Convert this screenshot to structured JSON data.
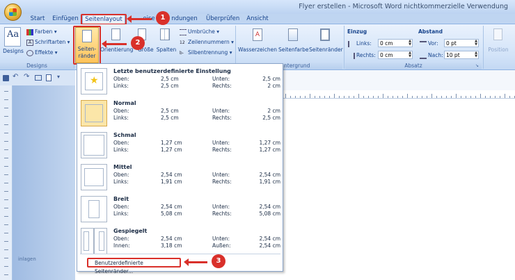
{
  "window": {
    "title": "Flyer erstellen - Microsoft Word nichtkommerzielle Verwendung"
  },
  "tabs": [
    "Start",
    "Einfügen",
    "Seitenlayout",
    "Verweise",
    "Sendungen",
    "Überprüfen",
    "Ansicht"
  ],
  "tabs_visible": {
    "start": "Start",
    "einfuegen": "Einfügen",
    "seitenlayout": "Seitenlayout",
    "verweise_tail": "eise",
    "sendungen_tail": "ndungen",
    "ueberpruefen": "Überprüfen",
    "ansicht": "Ansicht"
  },
  "ribbon": {
    "designs": {
      "label": "Designs",
      "group": "Designs",
      "farben": "Farben",
      "schriftarten": "Schriftarten",
      "effekte": "Effekte"
    },
    "seiteneinrichtung": {
      "seitenraender_line1": "Seiten-",
      "seitenraender_line2": "ränder",
      "orientierung": "Orientierung",
      "groesse": "Größe",
      "spalten": "Spalten",
      "umbrueche": "Umbrüche",
      "zeilennummern": "Zeilennummern",
      "silbentrennung": "Silbentrennung"
    },
    "seitenhintergrund": {
      "wasserzeichen": "Wasserzeichen",
      "seitenfarbe": "Seitenfarbe",
      "seitenraender": "Seitenränder",
      "group_tail": "ntergrund"
    },
    "absatz": {
      "group": "Absatz",
      "einzug": "Einzug",
      "links_label": "Links:",
      "links_value": "0 cm",
      "rechts_label": "Rechts:",
      "rechts_value": "0 cm",
      "abstand": "Abstand",
      "vor_label": "Vor:",
      "vor_value": "0 pt",
      "nach_label": "Nach:",
      "nach_value": "10 pt"
    },
    "position": "Position"
  },
  "margins_menu": {
    "items": [
      {
        "name": "Letzte benutzerdefinierte Einstellung",
        "k1": "Oben:",
        "v1": "2,5 cm",
        "k2": "Unten:",
        "v2": "2,5 cm",
        "k3": "Links:",
        "v3": "2,5 cm",
        "k4": "Rechts:",
        "v4": "2 cm"
      },
      {
        "name": "Normal",
        "k1": "Oben:",
        "v1": "2,5 cm",
        "k2": "Unten:",
        "v2": "2 cm",
        "k3": "Links:",
        "v3": "2,5 cm",
        "k4": "Rechts:",
        "v4": "2,5 cm"
      },
      {
        "name": "Schmal",
        "k1": "Oben:",
        "v1": "1,27 cm",
        "k2": "Unten:",
        "v2": "1,27 cm",
        "k3": "Links:",
        "v3": "1,27 cm",
        "k4": "Rechts:",
        "v4": "1,27 cm"
      },
      {
        "name": "Mittel",
        "k1": "Oben:",
        "v1": "2,54 cm",
        "k2": "Unten:",
        "v2": "2,54 cm",
        "k3": "Links:",
        "v3": "1,91 cm",
        "k4": "Rechts:",
        "v4": "1,91 cm"
      },
      {
        "name": "Breit",
        "k1": "Oben:",
        "v1": "2,54 cm",
        "k2": "Unten:",
        "v2": "2,54 cm",
        "k3": "Links:",
        "v3": "5,08 cm",
        "k4": "Rechts:",
        "v4": "5,08 cm"
      },
      {
        "name": "Gespiegelt",
        "k1": "Oben:",
        "v1": "2,54 cm",
        "k2": "Unten:",
        "v2": "2,54 cm",
        "k3": "Innen:",
        "v3": "3,18 cm",
        "k4": "Außen:",
        "v4": "2,54 cm"
      }
    ],
    "custom": "Benutzerdefinierte Seitenränder..."
  },
  "callouts": [
    "1",
    "2",
    "3"
  ],
  "left_pane_text": "inlagen",
  "colors": {
    "callout": "#d9302a",
    "ribbon": "#d2e3f8",
    "selected": "#fbe6a8"
  }
}
